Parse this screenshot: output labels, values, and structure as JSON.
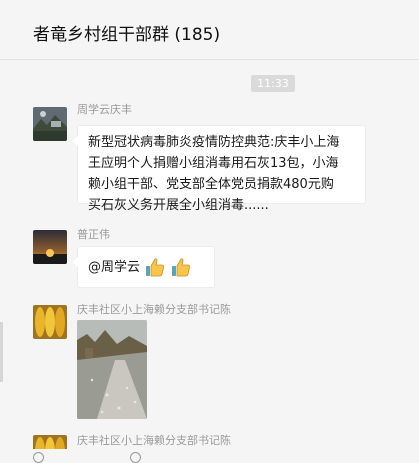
{
  "window": {
    "title": "者竜乡村组干部群 (185)"
  },
  "chat": {
    "time_label": "11:33",
    "messages": [
      {
        "sender": "周学云庆丰",
        "avatar": "avatar-landscape",
        "lines": [
          "新型冠状病毒肺炎疫情防控典范:庆丰小上海",
          "王应明个人捐赠小组消毒用石灰13包，小海",
          "赖小组干部、党支部全体党员捐款480元购",
          "买石灰义务开展全小组消毒......"
        ]
      },
      {
        "sender": "普正伟",
        "avatar": "avatar-sunset",
        "text": "@周学云",
        "emojis": [
          "thumbs-up-icon",
          "thumbs-up-icon"
        ]
      },
      {
        "sender": "庆丰社区小上海赖分支部书记陈",
        "avatar": "avatar-corn",
        "image": "photo-village-road"
      },
      {
        "sender": "庆丰社区小上海赖分支部书记陈",
        "avatar": "avatar-corn"
      }
    ]
  },
  "colors": {
    "background": "#f5f5f5",
    "bubble": "#ffffff",
    "sender": "#9a9a9a",
    "time_badge": "#dadada"
  }
}
